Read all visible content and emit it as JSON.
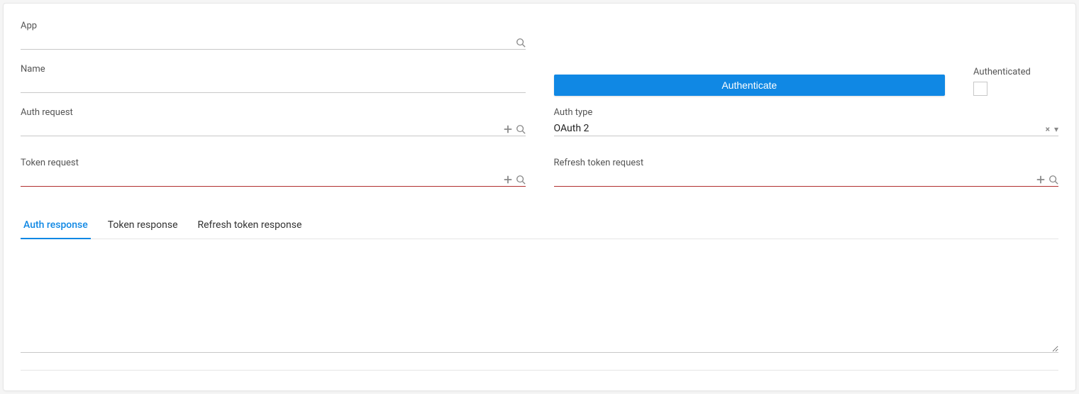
{
  "app_field": {
    "label": "App",
    "value": ""
  },
  "name_field": {
    "label": "Name",
    "value": ""
  },
  "auth_request_field": {
    "label": "Auth request",
    "value": ""
  },
  "token_request_field": {
    "label": "Token request",
    "value": ""
  },
  "refresh_token_request_field": {
    "label": "Refresh token request",
    "value": ""
  },
  "authenticate_button": "Authenticate",
  "authenticated_label": "Authenticated",
  "auth_type_label": "Auth type",
  "auth_type_value": "OAuth 2",
  "tabs": {
    "auth_response": "Auth response",
    "token_response": "Token response",
    "refresh_token_response": "Refresh token response"
  },
  "active_tab": "auth_response",
  "response_value": ""
}
